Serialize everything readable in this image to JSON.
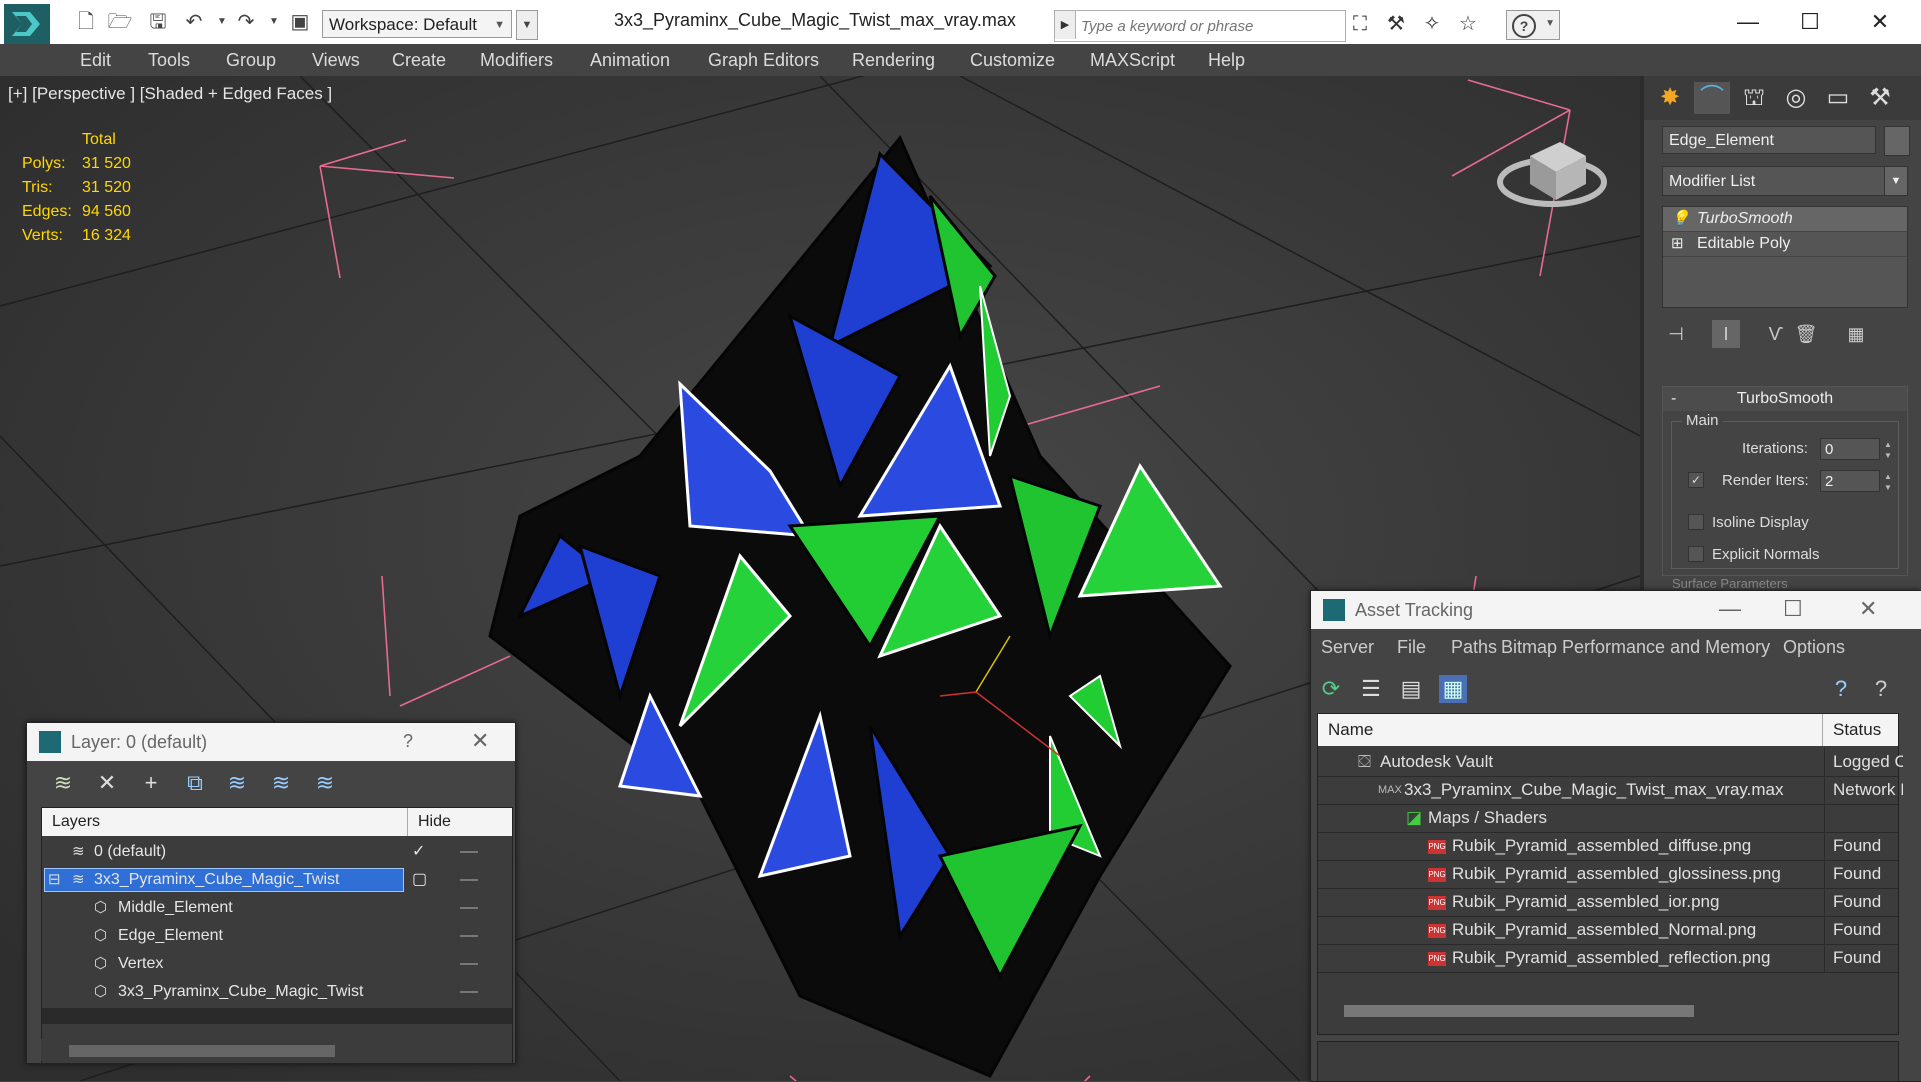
{
  "toolbar": {
    "workspace_label": "Workspace: Default",
    "title": "3x3_Pyraminx_Cube_Magic_Twist_max_vray.max",
    "search_placeholder": "Type a keyword or phrase"
  },
  "menu": [
    "Edit",
    "Tools",
    "Group",
    "Views",
    "Create",
    "Modifiers",
    "Animation",
    "Graph Editors",
    "Rendering",
    "Customize",
    "MAXScript",
    "Help"
  ],
  "viewport": {
    "label": "[+] [Perspective ] [Shaded + Edged Faces ]",
    "stats": {
      "header": "Total",
      "rows": [
        {
          "label": "Polys:",
          "value": "31 520"
        },
        {
          "label": "Tris:",
          "value": "31 520"
        },
        {
          "label": "Edges:",
          "value": "94 560"
        },
        {
          "label": "Verts:",
          "value": "16 324"
        }
      ]
    }
  },
  "command_panel": {
    "object_name": "Edge_Element",
    "modifier_list": "Modifier List",
    "stack": [
      {
        "name": "TurboSmooth",
        "icon": "lightbulb-icon",
        "selected": true
      },
      {
        "name": "Editable Poly",
        "icon": "plus-icon",
        "selected": false
      }
    ],
    "rollout": {
      "title": "TurboSmooth",
      "group": "Main",
      "iterations_label": "Iterations:",
      "iterations_value": "0",
      "render_iters_label": "Render Iters:",
      "render_iters_value": "2",
      "isoline_label": "Isoline Display",
      "explicit_normals_label": "Explicit Normals",
      "next_rollout_label": "Surface Parameters"
    }
  },
  "layer_panel": {
    "title": "Layer: 0 (default)",
    "help": "?",
    "columns": {
      "layers": "Layers",
      "hide": "Hide"
    },
    "rows": [
      {
        "name": "0 (default)",
        "indent": 0,
        "checked": true,
        "selected": false
      },
      {
        "name": "3x3_Pyraminx_Cube_Magic_Twist",
        "indent": 0,
        "checked": false,
        "selected": true
      },
      {
        "name": "Middle_Element",
        "indent": 1,
        "checked": false,
        "selected": false
      },
      {
        "name": "Edge_Element",
        "indent": 1,
        "checked": false,
        "selected": false
      },
      {
        "name": "Vertex",
        "indent": 1,
        "checked": false,
        "selected": false
      },
      {
        "name": "3x3_Pyraminx_Cube_Magic_Twist",
        "indent": 1,
        "checked": false,
        "selected": false
      }
    ]
  },
  "asset_panel": {
    "title": "Asset Tracking",
    "menu": [
      "Server",
      "File",
      "Paths",
      "Bitmap Performance and Memory",
      "Options"
    ],
    "columns": {
      "name": "Name",
      "status": "Status"
    },
    "rows": [
      {
        "name": "Autodesk Vault",
        "status": "Logged C",
        "indent": 0,
        "icon": "vault"
      },
      {
        "name": "3x3_Pyraminx_Cube_Magic_Twist_max_vray.max",
        "status": "Network I",
        "indent": 1,
        "icon": "max"
      },
      {
        "name": "Maps / Shaders",
        "status": "",
        "indent": 2,
        "icon": "maps"
      },
      {
        "name": "Rubik_Pyramid_assembled_diffuse.png",
        "status": "Found",
        "indent": 3,
        "icon": "png"
      },
      {
        "name": "Rubik_Pyramid_assembled_glossiness.png",
        "status": "Found",
        "indent": 3,
        "icon": "png"
      },
      {
        "name": "Rubik_Pyramid_assembled_ior.png",
        "status": "Found",
        "indent": 3,
        "icon": "png"
      },
      {
        "name": "Rubik_Pyramid_assembled_Normal.png",
        "status": "Found",
        "indent": 3,
        "icon": "png"
      },
      {
        "name": "Rubik_Pyramid_assembled_reflection.png",
        "status": "Found",
        "indent": 3,
        "icon": "png"
      }
    ]
  }
}
